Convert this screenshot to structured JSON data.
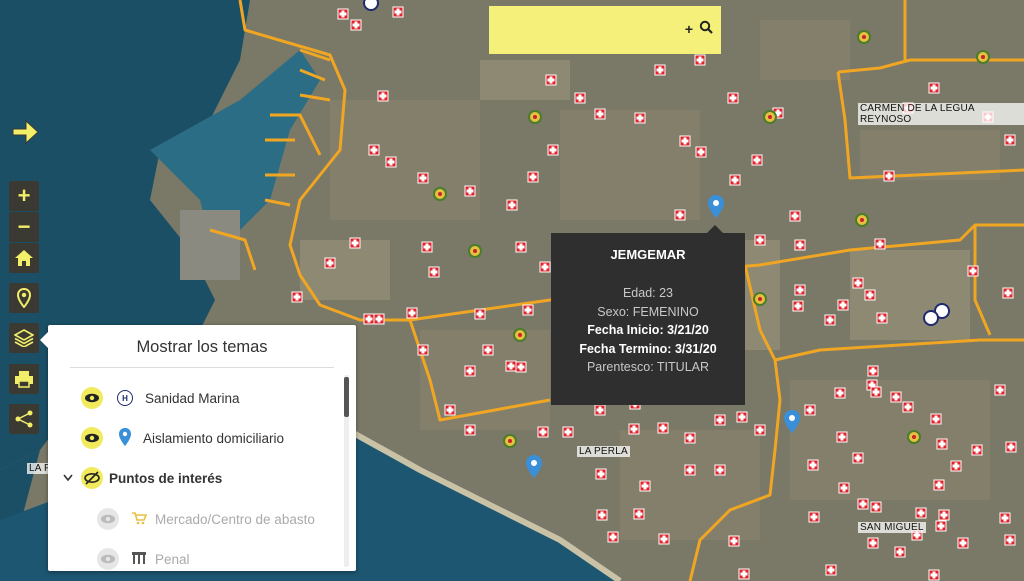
{
  "map": {
    "place_labels": [
      {
        "name": "carmen-de-la-legua-label",
        "text": "CARMEN DE LA LEGUA REYNOSO"
      },
      {
        "name": "la-perla-label",
        "text": "LA PERLA"
      },
      {
        "name": "san-miguel-label",
        "text": "SAN MIGUEL"
      },
      {
        "name": "la-punta-label",
        "text": "LA P"
      }
    ]
  },
  "search": {
    "placeholder": "",
    "value": ""
  },
  "toolbar": {
    "expand_icon": "arrow-right-icon",
    "zoom_in": "+",
    "zoom_out": "−",
    "home_icon": "home-icon",
    "locate_icon": "location-pin-icon",
    "layers_icon": "layers-icon",
    "print_icon": "printer-icon",
    "share_icon": "share-icon"
  },
  "popup": {
    "title": "JEMGEMAR",
    "edad": "Edad: 23",
    "sexo": "Sexo: FEMENINO",
    "fecha_inicio": "Fecha Inicio: 3/21/20",
    "fecha_termino": "Fecha Termino: 3/31/20",
    "parentesco": "Parentesco: TITULAR"
  },
  "layers_panel": {
    "title": "Mostrar los temas",
    "items": [
      {
        "label": "Sanidad Marina",
        "icon": "hospital-h-icon",
        "visible": true
      },
      {
        "label": "Aislamiento domiciliario",
        "icon": "blue-pin-icon",
        "visible": true
      },
      {
        "label": "Puntos de interés",
        "icon": "eye-slash-icon",
        "visible": false,
        "group": true
      },
      {
        "label": "Mercado/Centro de abasto",
        "icon": "cart-icon",
        "visible": false
      },
      {
        "label": "Penal",
        "icon": "prison-icon",
        "visible": false
      }
    ]
  },
  "colors": {
    "accent": "#f4f07a",
    "boundary": "#f0a623",
    "control_bg": "#3a3a33",
    "popup_bg": "#2f2f2f",
    "marker_red": "#e0232b",
    "pin_blue": "#3a8fd9"
  }
}
